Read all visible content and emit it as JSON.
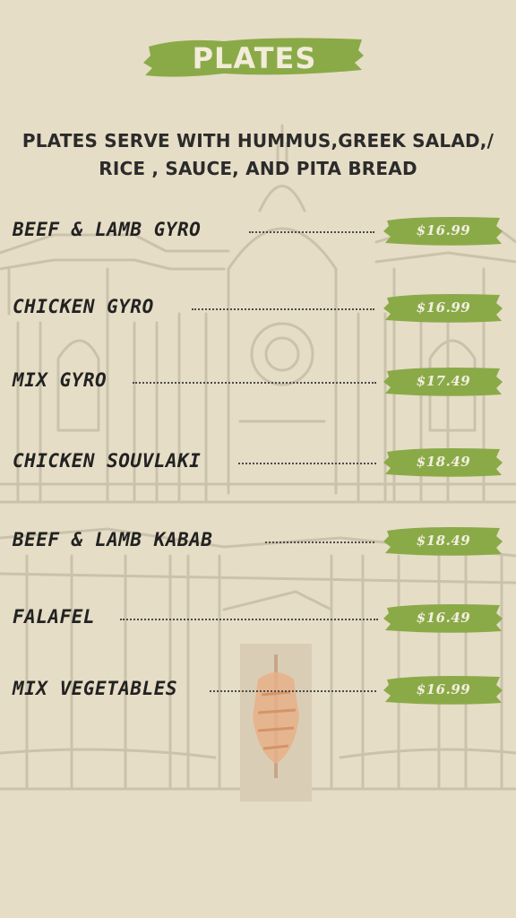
{
  "header": {
    "title": "PLATES",
    "subtitle_line1": "PLATES SERVE WITH HUMMUS,GREEK SALAD,/",
    "subtitle_line2": "RICE , SAUCE, AND PITA BREAD"
  },
  "colors": {
    "background": "#e6ddc6",
    "accent_green": "#8aaa48",
    "text_dark": "#222222",
    "sketch_lines": "#c9c0aa"
  },
  "menu": {
    "items": [
      {
        "name": "BEEF & LAMB GYRO",
        "price": "$16.99"
      },
      {
        "name": "CHICKEN GYRO",
        "price": "$16.99"
      },
      {
        "name": "MIX GYRO",
        "price": "$17.49"
      },
      {
        "name": "CHICKEN SOUVLAKI",
        "price": "$18.49"
      },
      {
        "name": "BEEF & LAMB KABAB",
        "price": "$18.49"
      },
      {
        "name": "FALAFEL",
        "price": "$16.49"
      },
      {
        "name": "MIX VEGETABLES",
        "price": "$16.99"
      }
    ]
  },
  "decor": {
    "background_icon": "petra-treasury-sketch-icon",
    "center_icon": "shawarma-spit-icon"
  }
}
